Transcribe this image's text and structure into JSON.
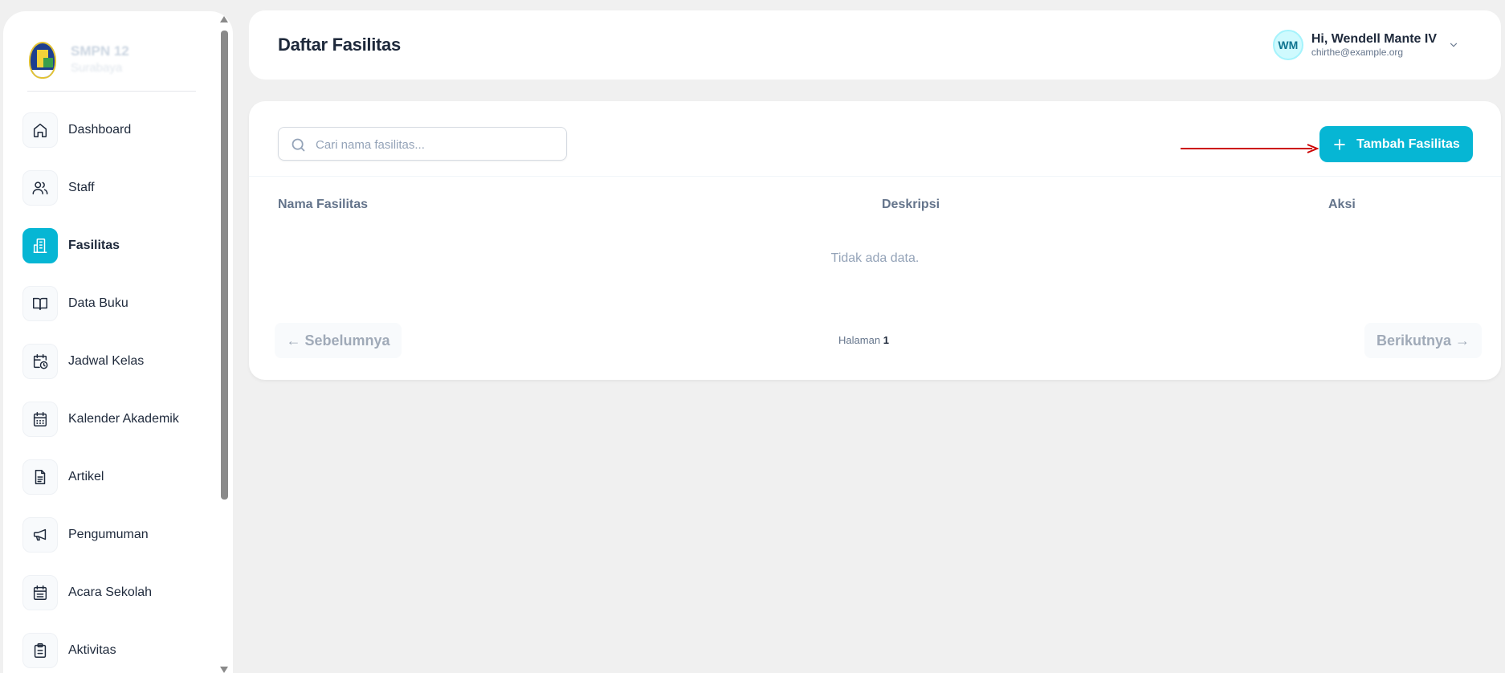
{
  "sidebar": {
    "brand": {
      "line1": "SMPN 12",
      "line2": "Surabaya"
    },
    "items": [
      {
        "label": "Dashboard",
        "icon": "home-icon"
      },
      {
        "label": "Staff",
        "icon": "users-icon"
      },
      {
        "label": "Fasilitas",
        "icon": "building-icon",
        "active": true
      },
      {
        "label": "Data Buku",
        "icon": "book-icon"
      },
      {
        "label": "Jadwal Kelas",
        "icon": "calendar-clock-icon"
      },
      {
        "label": "Kalender Akademik",
        "icon": "calendar-icon"
      },
      {
        "label": "Artikel",
        "icon": "document-icon"
      },
      {
        "label": "Pengumuman",
        "icon": "megaphone-icon"
      },
      {
        "label": "Acara Sekolah",
        "icon": "calendar-event-icon"
      },
      {
        "label": "Aktivitas",
        "icon": "clipboard-icon"
      }
    ]
  },
  "header": {
    "title": "Daftar Fasilitas",
    "user": {
      "initials": "WM",
      "greeting": "Hi, Wendell Mante IV",
      "email": "chirthe@example.org"
    }
  },
  "toolbar": {
    "search_placeholder": "Cari nama fasilitas...",
    "add_button": "Tambah Fasilitas"
  },
  "table": {
    "columns": [
      "Nama Fasilitas",
      "Deskripsi",
      "Aksi"
    ],
    "empty_text": "Tidak ada data."
  },
  "pagination": {
    "prev": "← Sebelumnya",
    "page_label": "Halaman",
    "page": "1",
    "next": "Berikutnya →"
  },
  "colors": {
    "accent": "#06b6d4",
    "annotation_arrow": "#cc0000"
  }
}
